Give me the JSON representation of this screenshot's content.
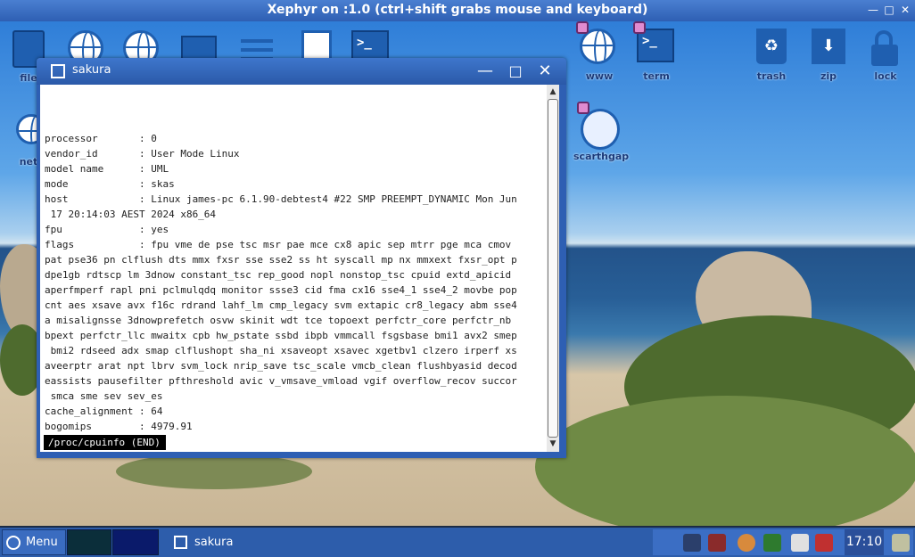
{
  "xephyr": {
    "title": "Xephyr on :1.0 (ctrl+shift grabs mouse and keyboard)"
  },
  "desktop_icons": [
    {
      "id": "files",
      "label": "file",
      "icon": "folder-icon"
    },
    {
      "id": "globe1",
      "label": "",
      "icon": "globe-icon"
    },
    {
      "id": "globe2",
      "label": "",
      "icon": "network-grid-icon"
    },
    {
      "id": "box",
      "label": "",
      "icon": "package-icon"
    },
    {
      "id": "sliders",
      "label": "",
      "icon": "settings-sliders-icon"
    },
    {
      "id": "editor",
      "label": "",
      "icon": "text-editor-icon"
    },
    {
      "id": "terminal-top",
      "label": "",
      "icon": "terminal-icon"
    },
    {
      "id": "www",
      "label": "www",
      "icon": "globe-icon"
    },
    {
      "id": "term",
      "label": "term",
      "icon": "terminal-icon"
    },
    {
      "id": "trash",
      "label": "trash",
      "icon": "recycle-bin-icon"
    },
    {
      "id": "zip",
      "label": "zip",
      "icon": "archive-icon"
    },
    {
      "id": "lock",
      "label": "lock",
      "icon": "padlock-icon"
    },
    {
      "id": "net",
      "label": "net",
      "icon": "network-icon"
    },
    {
      "id": "scarthgap",
      "label": "scarthgap",
      "icon": "dog-mascot-icon"
    }
  ],
  "window": {
    "title": "sakura",
    "terminal_lines": [
      "processor       : 0",
      "vendor_id       : User Mode Linux",
      "model name      : UML",
      "mode            : skas",
      "host            : Linux james-pc 6.1.90-debtest4 #22 SMP PREEMPT_DYNAMIC Mon Jun",
      " 17 20:14:03 AEST 2024 x86_64",
      "fpu             : yes",
      "flags           : fpu vme de pse tsc msr pae mce cx8 apic sep mtrr pge mca cmov",
      "pat pse36 pn clflush dts mmx fxsr sse sse2 ss ht syscall mp nx mmxext fxsr_opt p",
      "dpe1gb rdtscp lm 3dnow constant_tsc rep_good nopl nonstop_tsc cpuid extd_apicid",
      "aperfmperf rapl pni pclmulqdq monitor ssse3 cid fma cx16 sse4_1 sse4_2 movbe pop",
      "cnt aes xsave avx f16c rdrand lahf_lm cmp_legacy svm extapic cr8_legacy abm sse4",
      "a misalignsse 3dnowprefetch osvw skinit wdt tce topoext perfctr_core perfctr_nb",
      "bpext perfctr_llc mwaitx cpb hw_pstate ssbd ibpb vmmcall fsgsbase bmi1 avx2 smep",
      " bmi2 rdseed adx smap clflushopt sha_ni xsaveopt xsavec xgetbv1 clzero irperf xs",
      "aveerptr arat npt lbrv svm_lock nrip_save tsc_scale vmcb_clean flushbyasid decod",
      "eassists pausefilter pfthreshold avic v_vmsave_vmload vgif overflow_recov succor",
      " smca sme sev sev_es",
      "cache_alignment : 64",
      "bogomips        : 4979.91"
    ],
    "status_line": "/proc/cpuinfo (END)"
  },
  "taskbar": {
    "menu_label": "Menu",
    "task_label": "sakura",
    "clock": "17:10"
  }
}
